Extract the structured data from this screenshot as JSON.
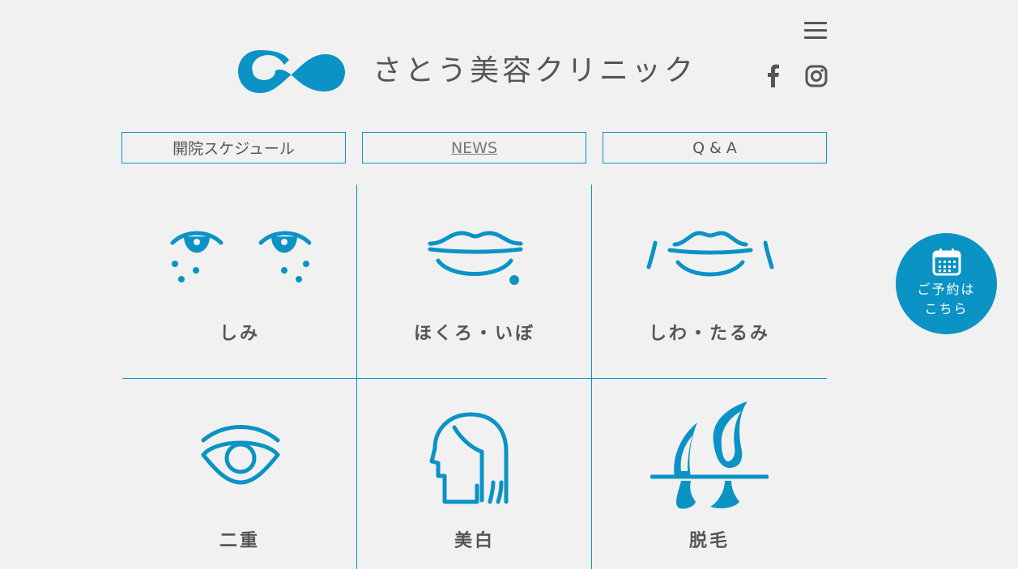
{
  "header": {
    "clinic_name": "さとう美容クリニック",
    "logo_icon": "infinity-drop-logo",
    "menu_icon": "hamburger-icon",
    "social": [
      "facebook-icon",
      "instagram-icon"
    ]
  },
  "nav": {
    "schedule_label": "開院スケジュール",
    "news_label": "NEWS",
    "qa_label": "Q & A"
  },
  "treatments": [
    {
      "label": "しみ",
      "icon": "spots-eyes-icon"
    },
    {
      "label": "ほくろ・いぼ",
      "icon": "mole-lips-icon"
    },
    {
      "label": "しわ・たるみ",
      "icon": "wrinkle-lips-icon"
    },
    {
      "label": "二重",
      "icon": "eye-icon"
    },
    {
      "label": "美白",
      "icon": "face-profile-icon"
    },
    {
      "label": "脱毛",
      "icon": "hair-follicle-icon"
    }
  ],
  "reserve": {
    "line1": "ご予約は",
    "line2": "こちら",
    "icon": "calendar-icon"
  },
  "colors": {
    "accent": "#0a93c4",
    "background": "#f1f1f1",
    "text": "#555555"
  }
}
